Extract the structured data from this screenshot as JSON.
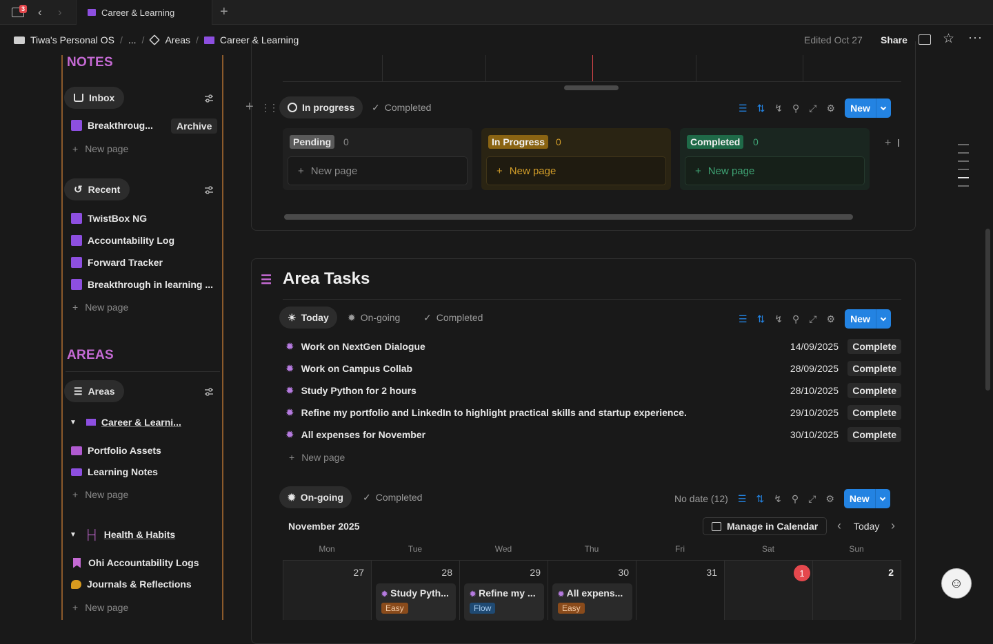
{
  "tabbar": {
    "notification_count": "3",
    "tab_title": "Career & Learning"
  },
  "breadcrumb": {
    "workspace": "Tiwa's Personal OS",
    "ellipsis": "...",
    "areas": "Areas",
    "current": "Career & Learning",
    "edited": "Edited Oct 27",
    "share": "Share"
  },
  "sidebar": {
    "notes_title": "NOTES",
    "inbox_label": "Inbox",
    "inbox_items": [
      {
        "label": "Breakthroug...",
        "tag": "Archive"
      }
    ],
    "new_page": "New page",
    "recent_label": "Recent",
    "recent_items": [
      "TwistBox NG",
      "Accountability Log",
      "Forward Tracker",
      "Breakthrough in learning ..."
    ],
    "areas_title": "AREAS",
    "areas_label": "Areas",
    "area_groups": [
      {
        "title": "Career & Learni...",
        "children": [
          "Portfolio Assets",
          "Learning Notes"
        ]
      },
      {
        "title": "Health & Habits",
        "children": [
          "Ohi Accountability Logs",
          "Journals & Reflections"
        ]
      }
    ]
  },
  "board": {
    "tabs": [
      "In progress",
      "Completed"
    ],
    "new_label": "New",
    "columns": [
      {
        "name": "Pending",
        "count": "0",
        "new_page": "New page"
      },
      {
        "name": "In Progress",
        "count": "0",
        "new_page": "New page"
      },
      {
        "name": "Completed",
        "count": "0",
        "new_page": "New page"
      }
    ]
  },
  "tasks": {
    "title": "Area Tasks",
    "tabs": [
      "Today",
      "On-going",
      "Completed"
    ],
    "new_label": "New",
    "rows": [
      {
        "title": "Work on NextGen Dialogue",
        "date": "14/09/2025",
        "status": "Complete"
      },
      {
        "title": "Work on Campus Collab",
        "date": "28/09/2025",
        "status": "Complete"
      },
      {
        "title": "Study Python for 2 hours",
        "date": "28/10/2025",
        "status": "Complete"
      },
      {
        "title": "Refine my portfolio and LinkedIn to highlight practical skills and startup experience.",
        "date": "29/10/2025",
        "status": "Complete"
      },
      {
        "title": "All expenses for November",
        "date": "30/10/2025",
        "status": "Complete"
      }
    ],
    "new_page": "New page"
  },
  "calendar": {
    "tabs": [
      "On-going",
      "Completed"
    ],
    "no_date": "No date (12)",
    "new_label": "New",
    "month": "November 2025",
    "manage": "Manage in Calendar",
    "today": "Today",
    "weekdays": [
      "Mon",
      "Tue",
      "Wed",
      "Thu",
      "Fri",
      "Sat",
      "Sun"
    ],
    "days": [
      "27",
      "28",
      "29",
      "30",
      "31",
      "1",
      "2"
    ],
    "events": [
      {
        "title": "Study Pyth...",
        "tag": "Easy"
      },
      {
        "title": "Refine my ...",
        "tag": "Flow"
      },
      {
        "title": "All expens...",
        "tag": "Easy"
      }
    ]
  },
  "colors": {
    "accent_blue": "#2383e2",
    "section_purple": "#c56ad4",
    "sidebar_border": "#8b5a2b",
    "today_red": "#e5484d"
  }
}
